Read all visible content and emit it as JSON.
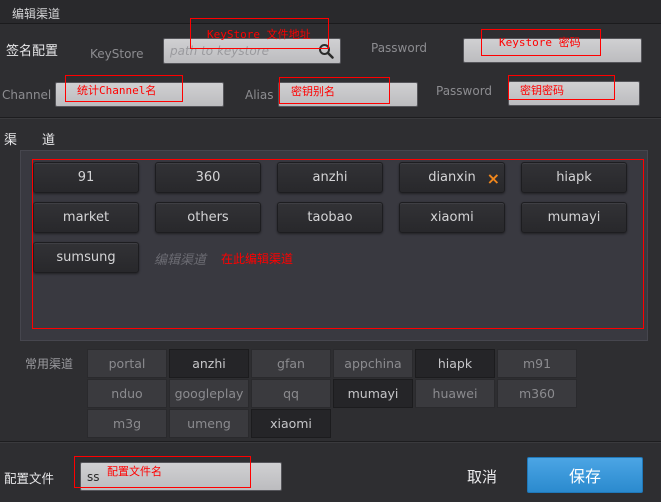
{
  "window": {
    "title": "编辑渠道"
  },
  "signing": {
    "section_label": "签名配置",
    "keystore": {
      "label": "KeyStore",
      "placeholder": "path to keystore",
      "value": ""
    },
    "keystore_password": {
      "label": "Password",
      "value": ""
    },
    "channel": {
      "label": "Channel",
      "value": ""
    },
    "alias": {
      "label": "Alias",
      "value": ""
    },
    "key_password": {
      "label": "Password",
      "value": ""
    }
  },
  "channels": {
    "label": "渠道",
    "items": [
      "91",
      "360",
      "anzhi",
      "dianxin",
      "hiapk",
      "market",
      "others",
      "taobao",
      "xiaomi",
      "mumayi",
      "sumsung"
    ],
    "remove_icon": "×",
    "edit_placeholder": "编辑渠道"
  },
  "common_channels": {
    "label": "常用渠道",
    "items": [
      {
        "name": "portal",
        "selected": false
      },
      {
        "name": "anzhi",
        "selected": true
      },
      {
        "name": "gfan",
        "selected": false
      },
      {
        "name": "appchina",
        "selected": false
      },
      {
        "name": "hiapk",
        "selected": true
      },
      {
        "name": "m91",
        "selected": false
      },
      {
        "name": "nduo",
        "selected": false
      },
      {
        "name": "googleplay",
        "selected": false
      },
      {
        "name": "qq",
        "selected": false
      },
      {
        "name": "mumayi",
        "selected": true
      },
      {
        "name": "huawei",
        "selected": false
      },
      {
        "name": "m360",
        "selected": false
      },
      {
        "name": "m3g",
        "selected": false
      },
      {
        "name": "umeng",
        "selected": false
      },
      {
        "name": "xiaomi",
        "selected": true
      }
    ]
  },
  "config_file": {
    "label": "配置文件",
    "value": "ss"
  },
  "actions": {
    "cancel": "取消",
    "save": "保存"
  },
  "annotations": {
    "keystore_path": "KeyStore 文件地址",
    "keystore_password": "Keystore 密码",
    "channel_name": "统计Channel名",
    "key_alias": "密钥别名",
    "key_password": "密钥密码",
    "edit_channels": "在此编辑渠道",
    "config_file_name": "配置文件名"
  },
  "icons": {
    "keystore_browse": "search-icon",
    "channel_remove": "close-icon"
  },
  "colors": {
    "accent": "#2e96e0",
    "remove_icon": "#f0861c",
    "annotation": "#ff0000",
    "background": "#2e2e31"
  }
}
